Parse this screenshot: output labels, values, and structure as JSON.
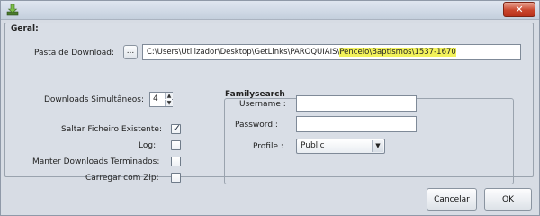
{
  "window": {
    "title": ""
  },
  "geral": {
    "title": "Geral:"
  },
  "download_path": {
    "label": "Pasta de Download:",
    "browse_label": "...",
    "value_prefix": "C:\\Users\\Utilizador\\Desktop\\GetLinks\\PAROQUIAIS\\",
    "value_highlight": "Pencelo\\Baptismos\\1537-1670"
  },
  "simultaneous": {
    "label": "Downloads Simultâneos:",
    "value": "4"
  },
  "options": {
    "skip_existing": {
      "label": "Saltar Ficheiro Existente:",
      "checked": true
    },
    "log": {
      "label": "Log:",
      "checked": false
    },
    "keep_finished": {
      "label": "Manter Downloads Terminados:",
      "checked": false
    },
    "load_zip": {
      "label": "Carregar com Zip:",
      "checked": false
    }
  },
  "familysearch": {
    "title": "Familysearch",
    "username_label": "Username :",
    "username_value": "",
    "password_label": "Password  :",
    "password_value": "",
    "profile_label": "Profile :",
    "profile_value": "Public"
  },
  "buttons": {
    "cancel": "Cancelar",
    "ok": "OK"
  },
  "colors": {
    "highlight": "#f2f25a",
    "close": "#c9452c"
  },
  "icons": {
    "app": "download-arrow-icon",
    "close": "close-icon",
    "check": "check-icon"
  }
}
